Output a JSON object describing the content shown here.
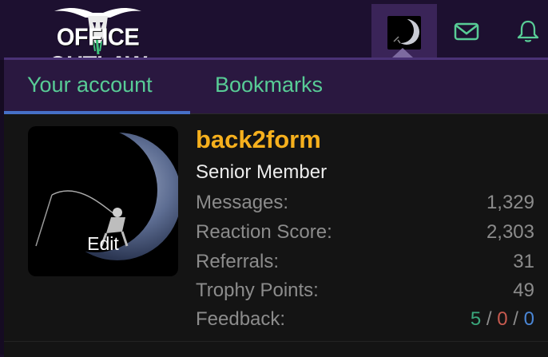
{
  "header": {
    "logo_text": "OFFICE OUTLAW"
  },
  "tabs": [
    {
      "label": "Your account"
    },
    {
      "label": "Bookmarks"
    }
  ],
  "profile": {
    "edit_label": "Edit",
    "username": "back2form",
    "user_title": "Senior Member",
    "stats": [
      {
        "label": "Messages:",
        "value": "1,329"
      },
      {
        "label": "Reaction Score:",
        "value": "2,303"
      },
      {
        "label": "Referrals:",
        "value": "31"
      },
      {
        "label": "Trophy Points:",
        "value": "49"
      }
    ],
    "feedback": {
      "label": "Feedback:",
      "positive": "5",
      "neutral": "0",
      "negative": "0",
      "separator": "/"
    }
  },
  "colors": {
    "accent_green": "#58cc96",
    "username_gold": "#f6b01d",
    "tab_underline": "#4670c7",
    "panel_bg": "#141414",
    "header_bg": "#1d1030"
  },
  "icons": {
    "messages": "envelope-icon",
    "alerts": "bell-icon",
    "avatar_menu": "moon-avatar-icon"
  }
}
